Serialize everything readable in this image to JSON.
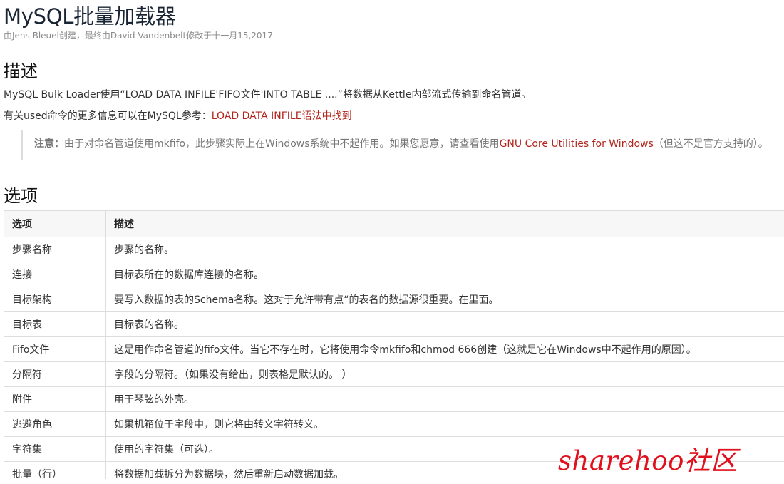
{
  "header": {
    "title": "MySQL批量加载器",
    "meta": "由Jens Bleuel创建，最终由David Vandenbelt修改于十一月15,2017"
  },
  "description": {
    "heading": "描述",
    "line1": "MySQL Bulk Loader使用“LOAD DATA INFILE'FIFO文件'INTO TABLE ....”将数据从Kettle内部流式传输到命名管道。",
    "line2_prefix": "有关used命令的更多信息可以在MySQL参考：",
    "line2_link": "LOAD DATA INFILE语法中找到",
    "note_label": "注意：",
    "note_text": "由于对命名管道使用mkfifo，此步骤实际上在Windows系统中不起作用。如果您愿意，请查看使用",
    "note_link": "GNU Core Utilities for Windows",
    "note_suffix": "（但这不是官方支持的）。"
  },
  "options": {
    "heading": "选项",
    "columns": [
      "选项",
      "描述"
    ],
    "rows": [
      [
        "步骤名称",
        "步骤的名称。"
      ],
      [
        "连接",
        "目标表所在的数据库连接的名称。"
      ],
      [
        "目标架构",
        "要写入数据的表的Schema名称。这对于允许带有点“的表名的数据源很重要。在里面。"
      ],
      [
        "目标表",
        "目标表的名称。"
      ],
      [
        "Fifo文件",
        "这是用作命名管道的fifo文件。当它不存在时，它将使用命令mkfifo和chmod 666创建（这就是它在Windows中不起作用的原因）。"
      ],
      [
        "分隔符",
        "字段的分隔符。（如果没有给出，则表格是默认的。 ）"
      ],
      [
        "附件",
        "用于琴弦的外壳。"
      ],
      [
        "逃避角色",
        "如果机箱位于字段中，则它将由转义字符转义。"
      ],
      [
        "字符集",
        "使用的字符集（可选）。"
      ],
      [
        "批量（行）",
        "将数据加载拆分为数据块，然后重新启动数据加载。"
      ]
    ]
  },
  "watermark": {
    "text": "sharehoo社区",
    "color": "#e0101c"
  },
  "colors": {
    "link": "#b3261e",
    "title": "#1a2533"
  }
}
